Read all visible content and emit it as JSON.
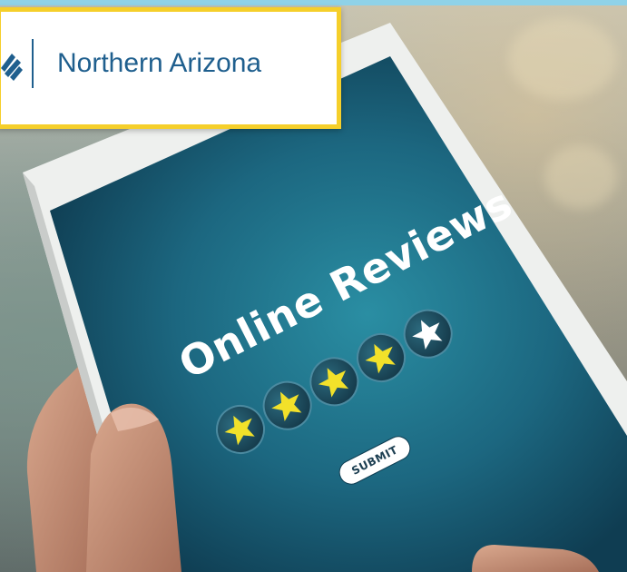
{
  "brand": {
    "name": "Northern Arizona",
    "accent": "#f5cf2b",
    "text_color": "#1f5f8e"
  },
  "tablet_screen": {
    "heading": "Online Reviews",
    "rating": {
      "filled": 4,
      "total": 5
    },
    "submit_label": "SUBMIT",
    "screen_color": "#1f6f85",
    "star_color": "#f2e12a"
  },
  "icons": [
    "logo-mark-icon",
    "star-icon"
  ]
}
